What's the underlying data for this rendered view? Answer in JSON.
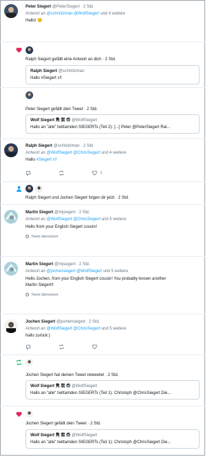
{
  "items": [
    {
      "name": "Peter Siegert",
      "handle": "@PeterSiegert",
      "time": "· 2 Std.",
      "reply_prefix": "Antwort an",
      "reply_to": [
        "@schnitziman",
        "@WolfSiegert"
      ],
      "reply_suffix": "und 4 weitere",
      "text": "Hallo!",
      "emoji": "🙂"
    },
    {
      "text": "Ralph Siegert gefällt eine Antwort an dich · 2 Std.",
      "quote": {
        "name": "Ralph Siegert",
        "handle": "@schnitziman",
        "text": "Hallo #Siegert s!!"
      }
    },
    {
      "text": "Peter Siegert gefällt dein Tweet · 2 Std.",
      "quote": {
        "name": "Wolf Siegert 隽 歆 岙",
        "handle": "@WolfSiegert",
        "text": "Hallo an \"alle\" twittamden SIEGERTs (Teil 2): [...] Peter @PeterSiegert Ral..."
      }
    },
    {
      "name": "Ralph Siegert",
      "handle": "@schnitziman",
      "time": "· 2 Std.",
      "reply_prefix": "Antwort an",
      "reply_to": [
        "@WolfSiegert",
        "@ChrisSiegert"
      ],
      "reply_suffix": "und 4 weitere",
      "text_prefix": "Hallo",
      "hashtag": "#Siegert s!!",
      "actions": {
        "reply": "",
        "retweet": "",
        "like": "1"
      }
    },
    {
      "text": "Ralph Siegert und Jochen Siegert folgen dir jetzt · 2 Std."
    },
    {
      "name": "Martin Siegert",
      "handle": "@mjsiegert",
      "time": "· 2 Std.",
      "reply_prefix": "Antwort an",
      "reply_to": [
        "@WolfSiegert",
        "@ChrisSiegert"
      ],
      "reply_suffix": "und 5 weitere",
      "text": "Hello from your English Siegert cousin!",
      "translate": "Tweet übersetzen"
    },
    {
      "name": "Martin Siegert",
      "handle": "@mjsiegert",
      "time": "· 2 Std.",
      "reply_prefix": "Antwort an",
      "reply_to": [
        "@jochensiegert",
        "@WolfSiegert"
      ],
      "reply_suffix": "und 5 weitere",
      "text": "Hello Jochen, from your English Siegert cousin! You probably known another",
      "text2": "Martin Siegert!!",
      "translate": "Tweet übersetzen"
    },
    {
      "name": "Jochen Siegert",
      "handle": "@jochensiegert",
      "time": "· 2 Std.",
      "reply_prefix": "Antwort an",
      "reply_to": [
        "@WolfSiegert",
        "@ChrisSiegert"
      ],
      "reply_suffix": "und 5 weitere",
      "text": "hallo zurück:)",
      "actions": {
        "reply": "",
        "retweet": "",
        "like": ""
      }
    },
    {
      "text": "Jochen Siegert hat deinen Tweet retweetet · 2 Std.",
      "quote": {
        "name": "Wolf Siegert 隽 歆 岙",
        "handle": "@WolfSiegert",
        "text": "Hallo an \"alle\" twittamden SIEGERTs (Teil 1): Christoph @ChrisSiegert Die..."
      }
    },
    {
      "text": "Jochen Siegert gefällt dein Tweet · 2 Std.",
      "quote": {
        "name": "Wolf Siegert 隽 歆 岙",
        "handle": "@WolfSiegert",
        "text": "Hallo an \"alle\" twittamden SIEGERTs (Teil 1): Christoph @ChrisSiegert Die..."
      }
    }
  ],
  "colors": {
    "accent": "#1da1f2",
    "like": "#e0245e",
    "retweet": "#17bf63",
    "muted": "#657786",
    "border": "#e6ecf0"
  }
}
